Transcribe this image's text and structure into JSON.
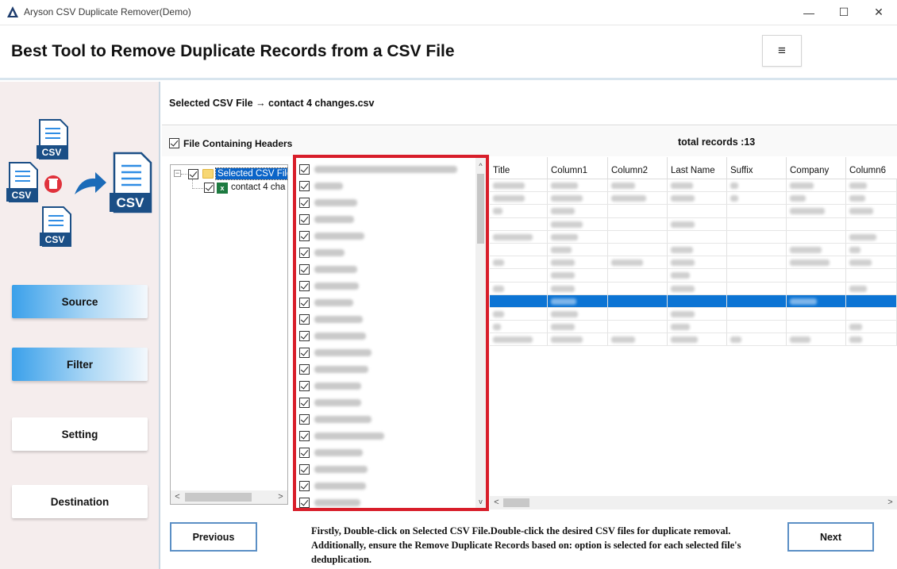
{
  "window": {
    "title": "Aryson CSV Duplicate Remover(Demo)",
    "minimize_glyph": "—",
    "maximize_glyph": "☐",
    "close_glyph": "✕"
  },
  "header": {
    "headline": "Best Tool to Remove Duplicate Records from a CSV File",
    "menu_glyph": "≡"
  },
  "sidebar": {
    "art_labels": [
      "CSV",
      "CSV",
      "CSV",
      "CSV"
    ],
    "nav": [
      {
        "label": "Source",
        "active": true
      },
      {
        "label": "Filter",
        "active": true
      },
      {
        "label": "Setting",
        "active": false
      },
      {
        "label": "Destination",
        "active": false
      }
    ]
  },
  "main": {
    "selected_file_text": "Selected CSV File → contact 4 changes.csv",
    "headers_checkbox_label": "File Containing Headers",
    "total_records": "total records :13",
    "tree": {
      "root_label": "Selected CSV File",
      "child_label": "contact 4 cha",
      "expander_glyph": "−",
      "xl_glyph": "x"
    },
    "column_list_count": 21,
    "grid": {
      "columns": [
        "Title",
        "Column1",
        "Column2",
        "Last Name",
        "Suffix",
        "Company",
        "Column6"
      ],
      "row_count": 13,
      "selected_row": 9
    },
    "scroll_glyphs": {
      "left": "<",
      "right": ">",
      "up": "^",
      "down": "v"
    }
  },
  "footer": {
    "previous_label": "Previous",
    "next_label": "Next",
    "instructions": "Firstly, Double-click on Selected CSV File.Double-click the desired CSV files for duplicate removal. Additionally, ensure the Remove Duplicate Records based on: option is selected for each selected file's deduplication."
  },
  "colors": {
    "accent_blue": "#3aa0ea",
    "highlight_red": "#d81e2a",
    "selection_blue": "#0c74d4"
  }
}
